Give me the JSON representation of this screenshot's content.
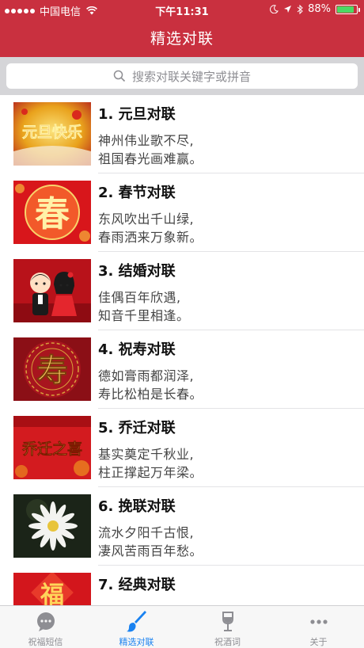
{
  "status_bar": {
    "carrier": "中国电信",
    "time": "下午11:31",
    "battery_percent": "88%",
    "battery_level": 0.88
  },
  "nav": {
    "title": "精选对联"
  },
  "search": {
    "placeholder": "搜索对联关键字或拼音"
  },
  "list": {
    "items": [
      {
        "title": "1. 元旦对联",
        "line1": "神州伟业歌不尽,",
        "line2": "祖国春光画难赢。",
        "thumb_icon": "new-year-banner-icon",
        "thumb_text": "元旦快乐"
      },
      {
        "title": "2. 春节对联",
        "line1": "东风吹出千山绿,",
        "line2": "春雨洒来万象新。",
        "thumb_icon": "spring-character-icon",
        "thumb_text": "春"
      },
      {
        "title": "3. 结婚对联",
        "line1": "佳偶百年欣遇,",
        "line2": "知音千里相逢。",
        "thumb_icon": "wedding-couple-icon",
        "thumb_text": ""
      },
      {
        "title": "4. 祝寿对联",
        "line1": "德如膏雨都润泽,",
        "line2": "寿比松柏是长春。",
        "thumb_icon": "longevity-character-icon",
        "thumb_text": "寿"
      },
      {
        "title": "5. 乔迁对联",
        "line1": "基实奠定千秋业,",
        "line2": "柱正撑起万年梁。",
        "thumb_icon": "housewarming-banner-icon",
        "thumb_text": "乔迁之喜"
      },
      {
        "title": "6. 挽联对联",
        "line1": "流水夕阳千古恨,",
        "line2": "凄风苦雨百年愁。",
        "thumb_icon": "white-chrysanthemum-icon",
        "thumb_text": ""
      },
      {
        "title": "7. 经典对联",
        "line1": "",
        "line2": "",
        "thumb_icon": "fortune-character-icon",
        "thumb_text": "福"
      }
    ]
  },
  "tab_bar": {
    "tabs": [
      {
        "label": "祝福短信",
        "icon": "chat-bubble-icon",
        "active": false
      },
      {
        "label": "精选对联",
        "icon": "brush-icon",
        "active": true
      },
      {
        "label": "祝酒词",
        "icon": "wine-glass-icon",
        "active": false
      },
      {
        "label": "关于",
        "icon": "more-dots-icon",
        "active": false
      }
    ]
  },
  "colors": {
    "nav_background": "#c9303f",
    "search_area_background": "#d5d5d8",
    "tab_active": "#1a82f0",
    "tab_inactive": "#8e8e93",
    "battery_fill": "#4cd964"
  }
}
